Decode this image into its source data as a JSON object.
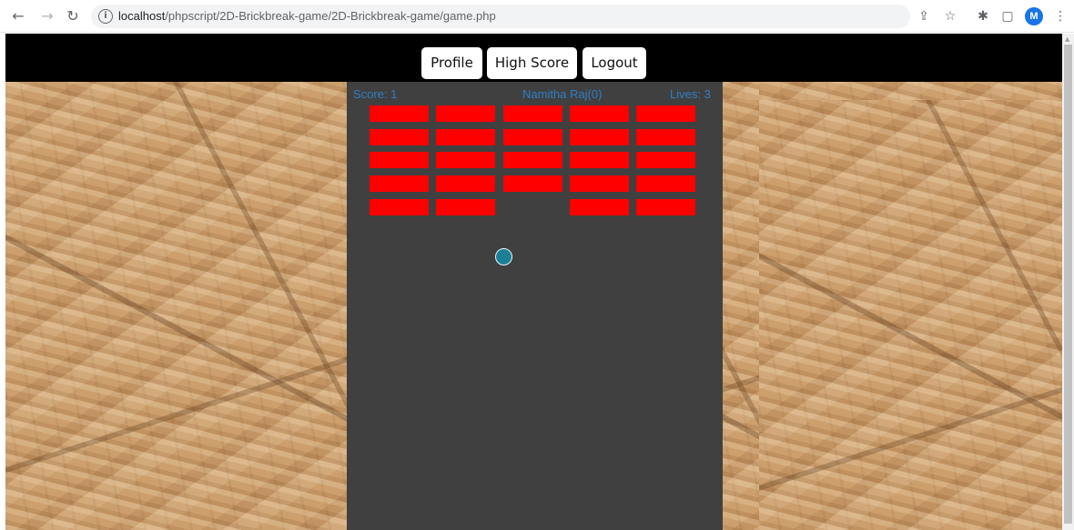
{
  "browser": {
    "url_host": "localhost",
    "url_path": "/phpscript/2D-Brickbreak-game/2D-Brickbreak-game/game.php",
    "avatar_letter": "M",
    "icons": {
      "back": "back-arrow-icon",
      "forward": "forward-arrow-icon",
      "reload": "reload-icon",
      "info": "info-icon",
      "share": "share-icon",
      "bookmark": "star-icon",
      "extensions": "puzzle-icon",
      "sidepanel": "side-panel-icon",
      "menu": "kebab-menu-icon"
    }
  },
  "nav": {
    "profile_label": "Profile",
    "highscore_label": "High Score",
    "logout_label": "Logout"
  },
  "game": {
    "score_text": "Score: 1",
    "player_text": "Namitha Raj(0)",
    "lives_text": "Lives: 3",
    "brick_color": "#ff0000",
    "ball_color": "#1d7f95",
    "background_color": "#404040",
    "hud_color": "#2f7fc7",
    "brick_rows": 5,
    "brick_columns": 5,
    "bricks": [
      [
        true,
        true,
        true,
        true,
        true
      ],
      [
        true,
        true,
        true,
        true,
        true
      ],
      [
        true,
        true,
        true,
        true,
        true
      ],
      [
        true,
        true,
        true,
        true,
        true
      ],
      [
        true,
        true,
        false,
        true,
        true
      ]
    ]
  }
}
